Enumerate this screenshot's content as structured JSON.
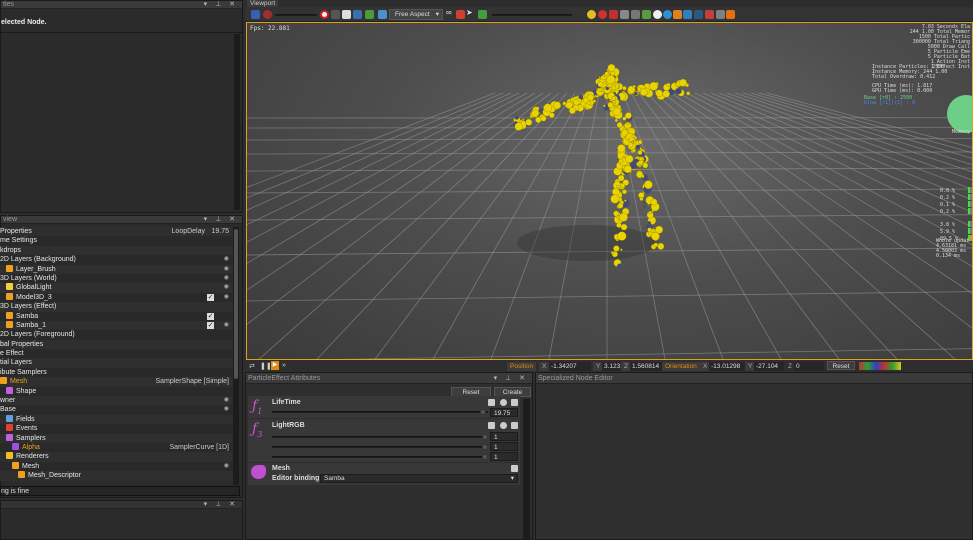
{
  "left_top_panel": {
    "title": "ties",
    "message": "elected Node."
  },
  "tree_panel": {
    "title": "view",
    "rows": [
      {
        "label": "Properties",
        "right": "LoopDelay",
        "value": "19.75"
      },
      {
        "label": "me Settings"
      },
      {
        "label": "kdrops"
      },
      {
        "label": "2D Layers (Background)",
        "eye": true
      },
      {
        "label": "Layer_Brush",
        "icon": "layer-icon",
        "eye": true,
        "indent": 1
      },
      {
        "label": "3D Layers (World)",
        "eye": true
      },
      {
        "label": "GlobalLight",
        "icon": "light-icon",
        "eye": true,
        "indent": 1
      },
      {
        "label": "Model3D_3",
        "icon": "cube-icon",
        "check": true,
        "eye": true,
        "indent": 1
      },
      {
        "label": "3D Layers (Effect)"
      },
      {
        "label": "Samba",
        "icon": "cube-icon",
        "check": true,
        "indent": 1
      },
      {
        "label": "Samba_1",
        "icon": "cube-icon",
        "check": true,
        "eye": true,
        "indent": 1
      },
      {
        "label": "2D Layers (Foreground)"
      },
      {
        "label": "bal Properties"
      },
      {
        "label": "e Effect"
      },
      {
        "label": "tial Layers"
      },
      {
        "label": "ibute Samplers"
      },
      {
        "label": "Mesh",
        "icon": "mesh-icon",
        "right": "SamplerShape [Simple]",
        "orange": true,
        "indent": 0
      },
      {
        "label": "Shape",
        "icon": "shape-icon",
        "indent": 1
      },
      {
        "label": "wner",
        "eye": true
      },
      {
        "label": "Base",
        "eye": true
      },
      {
        "label": "Fields",
        "icon": "fields-icon",
        "indent": 1
      },
      {
        "label": "Events",
        "icon": "events-icon",
        "indent": 1
      },
      {
        "label": "Samplers",
        "icon": "samplers-icon",
        "indent": 1
      },
      {
        "label": "Alpha",
        "icon": "curve-icon",
        "right": "SamplerCurve [1D]",
        "orange": true,
        "indent": 2
      },
      {
        "label": "Renderers",
        "icon": "renderers-icon",
        "indent": 1
      },
      {
        "label": "Mesh",
        "icon": "cube-icon",
        "eye": true,
        "indent": 2
      },
      {
        "label": "Mesh_Descriptor",
        "icon": "cube-icon",
        "indent": 3
      }
    ],
    "status": "ng is fine"
  },
  "viewport": {
    "title": "Viewport",
    "aspect": "Free Aspect",
    "fps": "Fps: 22.881",
    "stats_top": [
      "7.03 Seconds Ela",
      "244 1.00 Total Memor",
      "1500 Total Partic",
      "300000 Total Triang",
      "5000 Draw Call",
      "5 Particle Eme",
      "5 Particle Bat",
      "1 Action Inst",
      "1 Effect Inst"
    ],
    "stats_mid": [
      "Instance Particles: 2500",
      "Instance Memory: 244 1.00",
      "Total Overdraw: 0.412"
    ],
    "stats_gpu": [
      "CPU Time (ms): 1.817",
      "GPU Time (ms): 0.000"
    ],
    "base_line": "Base [r0] : 2500",
    "glow_line": "Glow [r1][r2] : 0",
    "memory_label": "Memory",
    "percents": [
      "0.0 %",
      "0.2 %",
      "0.1 %",
      "0.2 %",
      "3.8 %",
      "5.9 %",
      "89.5 %"
    ],
    "update_lines": [
      "Whole updat",
      "4.63181 ms",
      "4.50003 ms",
      "0.134 ms"
    ]
  },
  "transform_bar": {
    "position_label": "Position",
    "x_label": "X",
    "x": "-1.34207",
    "y_label": "Y",
    "y": "3.123174",
    "z_label": "Z",
    "z": "1.560814",
    "orientation_label": "Orientation",
    "ox": "-13.01298",
    "oy": "-27.104",
    "oz": "0",
    "reset": "Reset"
  },
  "attributes_panel": {
    "title": "ParticleEffect Attributes",
    "reset": "Reset",
    "create": "Create",
    "lifetime": {
      "label": "LifeTime",
      "value": "19.75",
      "fn": "f1"
    },
    "lightrgb": {
      "label": "LightRGB",
      "values": [
        "1",
        "1",
        "1"
      ],
      "fn": "f3"
    },
    "mesh": {
      "label": "Mesh",
      "binding_label": "Editor binding :",
      "binding_value": "Samba"
    }
  },
  "node_editor": {
    "title": "Specialized Node Editor"
  },
  "colors": {
    "accent": "#e0a020",
    "particle": "#e8d400",
    "particle_blue": "#404a80"
  }
}
